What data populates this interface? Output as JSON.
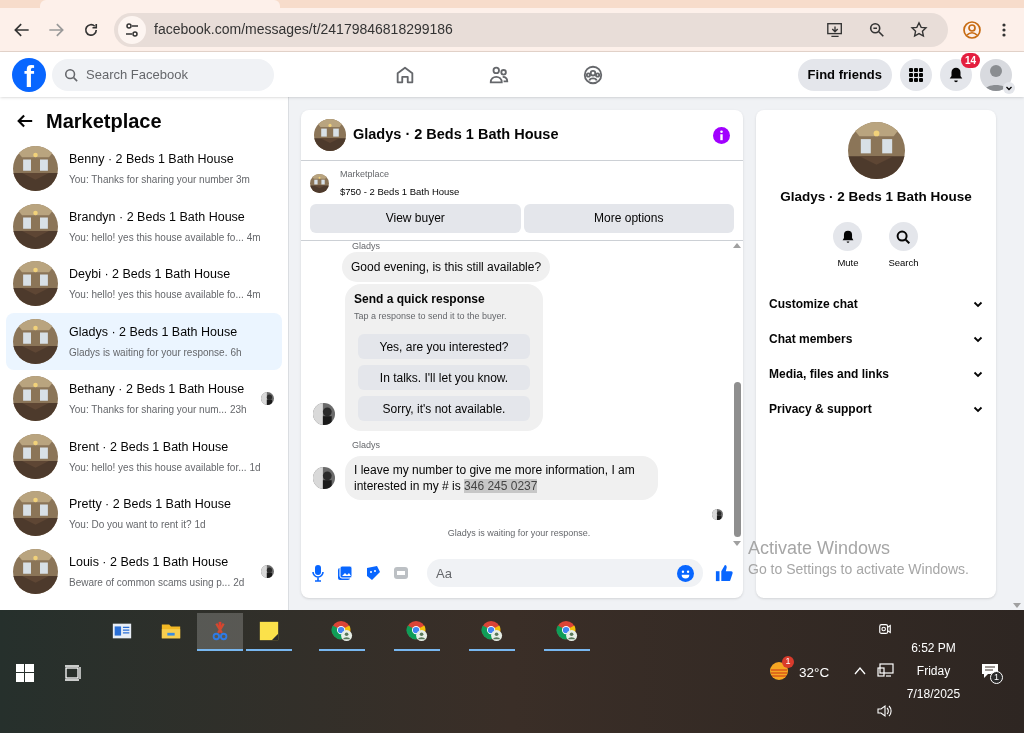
{
  "browser": {
    "url": "facebook.com/messages/t/24179846818299186"
  },
  "header": {
    "logo": "f",
    "search_placeholder": "Search Facebook",
    "find_friends": "Find friends",
    "notification_count": "14"
  },
  "sidebar": {
    "title": "Marketplace",
    "items": [
      {
        "name": "Benny · 2 Beds 1 Bath House",
        "preview": "You: Thanks for sharing your number",
        "time": "3m",
        "selected": false,
        "seen": false
      },
      {
        "name": "Brandyn · 2 Beds 1 Bath House",
        "preview": "You: hello! yes this house available fo...",
        "time": "4m",
        "selected": false,
        "seen": false
      },
      {
        "name": "Deybi · 2 Beds 1 Bath House",
        "preview": "You: hello! yes this house available fo...",
        "time": "4m",
        "selected": false,
        "seen": false
      },
      {
        "name": "Gladys · 2 Beds 1 Bath House",
        "preview": "Gladys is waiting for your response.",
        "time": "6h",
        "selected": true,
        "seen": false
      },
      {
        "name": "Bethany · 2 Beds 1 Bath House",
        "preview": "You: Thanks for sharing your num...",
        "time": "23h",
        "selected": false,
        "seen": true
      },
      {
        "name": "Brent · 2 Beds 1 Bath House",
        "preview": "You: hello! yes this house available for...",
        "time": "1d",
        "selected": false,
        "seen": false
      },
      {
        "name": "Pretty · 2 Beds 1 Bath House",
        "preview": "You: Do you want to rent it?",
        "time": "1d",
        "selected": false,
        "seen": false
      },
      {
        "name": "Louis · 2 Beds 1 Bath House",
        "preview": "Beware of common scams using p...",
        "time": "2d",
        "selected": false,
        "seen": true
      }
    ]
  },
  "chat": {
    "title": "Gladys · 2 Beds 1 Bath House",
    "listing_label": "Marketplace",
    "listing_title": "$750 - 2 Beds 1 Bath House",
    "buttons": [
      "View buyer",
      "More options"
    ],
    "top_sender": "Gladys",
    "first_message": "Good evening, is this still available?",
    "quick": {
      "title": "Send a quick response",
      "subtitle": "Tap a response to send it to the buyer.",
      "options": [
        "Yes, are you interested?",
        "In talks. I'll let you know.",
        "Sorry, it's not available."
      ]
    },
    "sender": "Gladys",
    "message": "I leave my number to give me more information, I am interested in my # is",
    "message_selected": "346 245 0237",
    "status": "Gladys is waiting for your response.",
    "composer_placeholder": "Aa"
  },
  "details": {
    "title": "Gladys · 2 Beds 1 Bath House",
    "actions": [
      {
        "kind": "mute",
        "label": "Mute"
      },
      {
        "kind": "search",
        "label": "Search"
      }
    ],
    "sections": [
      {
        "label": "Customize chat",
        "expanded": false
      },
      {
        "label": "Chat members",
        "expanded": false
      },
      {
        "label": "Media, files and links",
        "expanded": false
      },
      {
        "label": "Privacy & support",
        "expanded": false
      }
    ]
  },
  "activation": {
    "title": "Activate Windows",
    "subtitle": "Go to Settings to activate Windows."
  },
  "taskbar": {
    "apps": [
      {
        "kind": "news",
        "running": false,
        "selected": false
      },
      {
        "kind": "folder",
        "running": false,
        "selected": false
      },
      {
        "kind": "snip",
        "running": true,
        "selected": true
      },
      {
        "kind": "notes",
        "running": true,
        "selected": false
      },
      {
        "kind": "chrome",
        "running": true,
        "selected": false
      },
      {
        "kind": "chrome",
        "running": true,
        "selected": false
      },
      {
        "kind": "chrome",
        "running": true,
        "selected": false
      },
      {
        "kind": "chrome",
        "running": true,
        "selected": false
      }
    ],
    "weather_badge": "1",
    "temperature": "32°C",
    "time": "6:52 PM",
    "day": "Friday",
    "date": "7/18/2025",
    "notifications": "1"
  }
}
